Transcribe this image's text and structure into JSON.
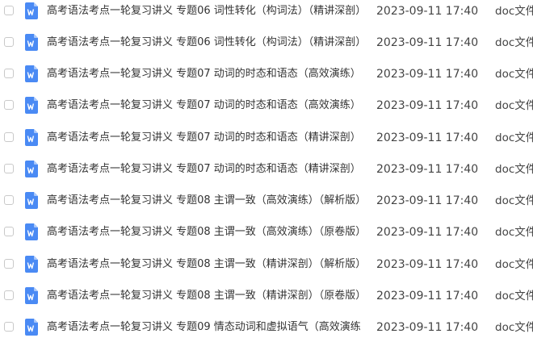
{
  "file_list": {
    "icon": "word-doc-icon",
    "icon_color": "#4A8AF4",
    "rows": [
      {
        "name": "高考语法考点一轮复习讲义 专题06 词性转化（构词法）（精讲深剖）（",
        "date": "2023-09-11 17:40",
        "type": "doc文件"
      },
      {
        "name": "高考语法考点一轮复习讲义 专题06 词性转化（构词法）（精讲深剖）（",
        "date": "2023-09-11 17:40",
        "type": "doc文件"
      },
      {
        "name": "高考语法考点一轮复习讲义 专题07 动词的时态和语态（高效演练）（解",
        "date": "2023-09-11 17:40",
        "type": "doc文件"
      },
      {
        "name": "高考语法考点一轮复习讲义 专题07 动词的时态和语态（高效演练）（原",
        "date": "2023-09-11 17:40",
        "type": "doc文件"
      },
      {
        "name": "高考语法考点一轮复习讲义 专题07 动词的时态和语态（精讲深剖）（解",
        "date": "2023-09-11 17:40",
        "type": "doc文件"
      },
      {
        "name": "高考语法考点一轮复习讲义 专题07 动词的时态和语态（精讲深剖）（原",
        "date": "2023-09-11 17:40",
        "type": "doc文件"
      },
      {
        "name": "高考语法考点一轮复习讲义 专题08 主谓一致（高效演练）（解析版）.doc",
        "date": "2023-09-11 17:40",
        "type": "doc文件"
      },
      {
        "name": "高考语法考点一轮复习讲义 专题08 主谓一致（高效演练）（原卷版）.doc",
        "date": "2023-09-11 17:40",
        "type": "doc文件"
      },
      {
        "name": "高考语法考点一轮复习讲义 专题08 主谓一致（精讲深剖）（解析版）.doc",
        "date": "2023-09-11 17:40",
        "type": "doc文件"
      },
      {
        "name": "高考语法考点一轮复习讲义 专题08 主谓一致（精讲深剖）（原卷版）.doc",
        "date": "2023-09-11 17:40",
        "type": "doc文件"
      },
      {
        "name": "高考语法考点一轮复习讲义 专题09 情态动词和虚拟语气（高效演练）（",
        "date": "2023-09-11 17:40",
        "type": "doc文件"
      }
    ]
  }
}
